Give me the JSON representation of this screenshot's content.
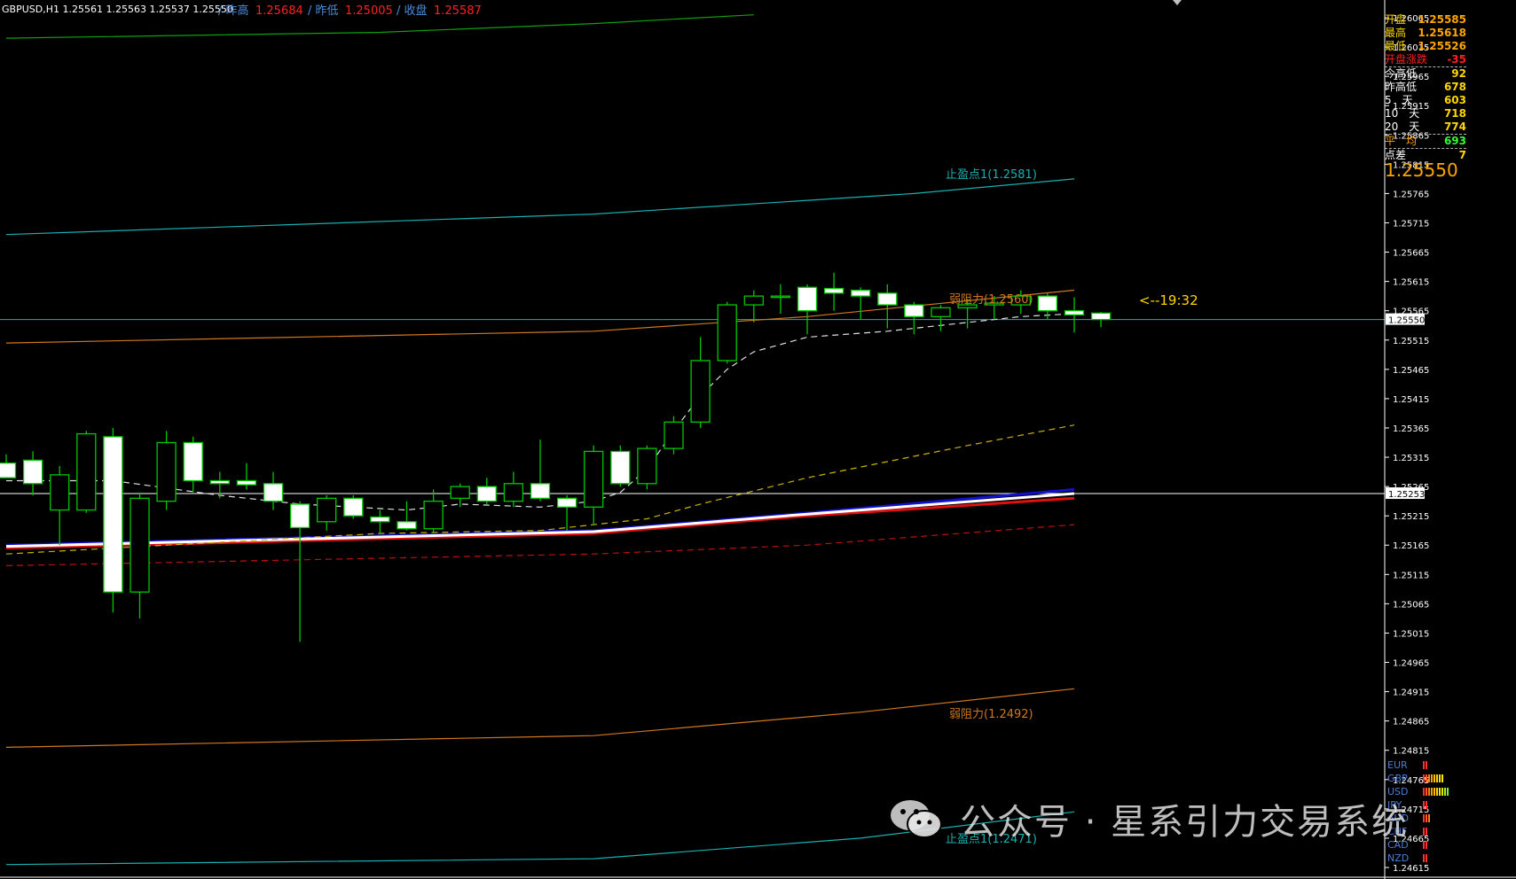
{
  "window": {
    "symbol_line": "GBPUSD,H1  1.25561 1.25563 1.25537 1.25550",
    "prev_high_label": "/ 昨高",
    "prev_high_value": "1.25684",
    "prev_low_label": "/ 昨低",
    "prev_low_value": "1.25005",
    "prev_close_label": "/ 收盘",
    "prev_close_value": "1.25587"
  },
  "stats_panel": {
    "rows": [
      {
        "label": "开盘",
        "value": "1.25585",
        "label_color": "#ffd700",
        "value_color": "#ffa500"
      },
      {
        "label": "最高",
        "value": "1.25618",
        "label_color": "#ffd700",
        "value_color": "#ffa500"
      },
      {
        "label": "最低",
        "value": "1.25526",
        "label_color": "#ffd700",
        "value_color": "#ffa500"
      },
      {
        "label": "开盘涨跌",
        "value": "-35",
        "label_color": "#ff2020",
        "value_color": "#ff2020"
      },
      {
        "label": "今高低",
        "value": "92",
        "label_color": "#ffffff",
        "value_color": "#ffd700"
      },
      {
        "label": "昨高低",
        "value": "678",
        "label_color": "#ffffff",
        "value_color": "#ffd700"
      },
      {
        "label": "5　天",
        "value": "603",
        "label_color": "#ffffff",
        "value_color": "#ffd700"
      },
      {
        "label": "10　天",
        "value": "718",
        "label_color": "#ffffff",
        "value_color": "#ffd700"
      },
      {
        "label": "20　天",
        "value": "774",
        "label_color": "#ffffff",
        "value_color": "#ffd700"
      },
      {
        "label": "平　均",
        "value": "693",
        "label_color": "#ffa500",
        "value_color": "#33ff33"
      },
      {
        "label": "点差",
        "value": "7",
        "label_color": "#ffffff",
        "value_color": "#ffd700"
      }
    ],
    "current_price": "1.25550"
  },
  "annotations": {
    "tp_upper": "止盈点1(1.2581)",
    "resist_upper": "弱阻力(1.2560)",
    "timer": "<--19:32",
    "resist_lower": "弱阻力(1.2492)",
    "tp_lower": "止盈点1(1.2471)"
  },
  "currency_strength": [
    {
      "name": "EUR",
      "level": 2,
      "colors": [
        "#ff3030",
        "#ff3030"
      ]
    },
    {
      "name": "GBP",
      "level": 8,
      "colors": [
        "#ff3030",
        "#ff5a20",
        "#ff8010",
        "#ffa000",
        "#ffc000",
        "#ffd400",
        "#ffe000",
        "#ffe800"
      ]
    },
    {
      "name": "USD",
      "level": 10,
      "colors": [
        "#ff3030",
        "#ff5a20",
        "#ff8010",
        "#ffa000",
        "#ffc000",
        "#ffd400",
        "#ffe000",
        "#d8f000",
        "#a8f020",
        "#70f030"
      ]
    },
    {
      "name": "JPY",
      "level": 2,
      "colors": [
        "#ff3030",
        "#ff3030"
      ]
    },
    {
      "name": "AUD",
      "level": 3,
      "colors": [
        "#ff3030",
        "#ff5a20",
        "#ff8010"
      ]
    },
    {
      "name": "CHF",
      "level": 2,
      "colors": [
        "#ff3030",
        "#ff3030"
      ]
    },
    {
      "name": "CAD",
      "level": 2,
      "colors": [
        "#ff3030",
        "#ff3030"
      ]
    },
    {
      "name": "NZD",
      "level": 2,
      "colors": [
        "#ff3030",
        "#ff3030"
      ]
    }
  ],
  "watermark": "公众号 · 星系引力交易系统",
  "colors": {
    "background": "#000000",
    "bull_candle": "#000000",
    "bear_candle": "#ffffff",
    "wick": "#00c800",
    "tp_line": "#1ab0b0",
    "resist_line": "#d07820",
    "ma_white": "#ffffff",
    "ma_blue": "#1010d0",
    "ma_red": "#e01010",
    "ma_dashed_red": "#c01010",
    "ma_dashed_yellow": "#c8b400",
    "ma_dashed_white": "#e0e0e0",
    "top_green": "#10a010",
    "hline": "#ffffff",
    "price_line": "#1ab0b0"
  },
  "chart_data": {
    "type": "candlestick",
    "symbol": "GBPUSD",
    "timeframe": "H1",
    "ylim": [
      1.24615,
      1.26065
    ],
    "y_ticks": [
      "1.26065",
      "1.26015",
      "1.25965",
      "1.25915",
      "1.25865",
      "1.25815",
      "1.25765",
      "1.25715",
      "1.25665",
      "1.25615",
      "1.25565",
      "1.25515",
      "1.25465",
      "1.25415",
      "1.25365",
      "1.25315",
      "1.25265",
      "1.25215",
      "1.25165",
      "1.25115",
      "1.25065",
      "1.25015",
      "1.24965",
      "1.24915",
      "1.24865",
      "1.24815",
      "1.24765",
      "1.24715",
      "1.24665",
      "1.24615"
    ],
    "price_labels": [
      {
        "value": "1.25550",
        "y": 1.2555
      },
      {
        "value": "1.25253",
        "y": 1.25253
      }
    ],
    "horizontal_lines": [
      1.25253
    ],
    "candles": [
      {
        "o": 1.25305,
        "h": 1.2532,
        "l": 1.2528,
        "c": 1.2528
      },
      {
        "o": 1.2531,
        "h": 1.25325,
        "l": 1.2525,
        "c": 1.2527
      },
      {
        "o": 1.25225,
        "h": 1.253,
        "l": 1.25165,
        "c": 1.25285
      },
      {
        "o": 1.25225,
        "h": 1.2536,
        "l": 1.2522,
        "c": 1.25355
      },
      {
        "o": 1.2535,
        "h": 1.25365,
        "l": 1.2505,
        "c": 1.25085
      },
      {
        "o": 1.25085,
        "h": 1.25255,
        "l": 1.2504,
        "c": 1.25245
      },
      {
        "o": 1.2524,
        "h": 1.2536,
        "l": 1.25225,
        "c": 1.2534
      },
      {
        "o": 1.2534,
        "h": 1.2535,
        "l": 1.25255,
        "c": 1.25275
      },
      {
        "o": 1.25275,
        "h": 1.2529,
        "l": 1.25245,
        "c": 1.2527
      },
      {
        "o": 1.25275,
        "h": 1.25305,
        "l": 1.2526,
        "c": 1.25268
      },
      {
        "o": 1.2527,
        "h": 1.2529,
        "l": 1.25225,
        "c": 1.2524
      },
      {
        "o": 1.25235,
        "h": 1.2524,
        "l": 1.25,
        "c": 1.25195
      },
      {
        "o": 1.25205,
        "h": 1.2525,
        "l": 1.2519,
        "c": 1.25245
      },
      {
        "o": 1.25245,
        "h": 1.2525,
        "l": 1.2521,
        "c": 1.25215
      },
      {
        "o": 1.25213,
        "h": 1.25225,
        "l": 1.25185,
        "c": 1.25205
      },
      {
        "o": 1.25205,
        "h": 1.2524,
        "l": 1.2519,
        "c": 1.25193
      },
      {
        "o": 1.25193,
        "h": 1.2526,
        "l": 1.25185,
        "c": 1.2524
      },
      {
        "o": 1.25245,
        "h": 1.2527,
        "l": 1.2523,
        "c": 1.25265
      },
      {
        "o": 1.25265,
        "h": 1.2528,
        "l": 1.25235,
        "c": 1.2524
      },
      {
        "o": 1.2524,
        "h": 1.2529,
        "l": 1.2523,
        "c": 1.2527
      },
      {
        "o": 1.2527,
        "h": 1.25345,
        "l": 1.2524,
        "c": 1.25245
      },
      {
        "o": 1.25245,
        "h": 1.2525,
        "l": 1.2519,
        "c": 1.2523
      },
      {
        "o": 1.2523,
        "h": 1.25335,
        "l": 1.252,
        "c": 1.25325
      },
      {
        "o": 1.25325,
        "h": 1.25335,
        "l": 1.25265,
        "c": 1.2527
      },
      {
        "o": 1.2527,
        "h": 1.25335,
        "l": 1.2526,
        "c": 1.2533
      },
      {
        "o": 1.2533,
        "h": 1.25385,
        "l": 1.2532,
        "c": 1.25375
      },
      {
        "o": 1.25375,
        "h": 1.2552,
        "l": 1.25365,
        "c": 1.2548
      },
      {
        "o": 1.2548,
        "h": 1.2558,
        "l": 1.25475,
        "c": 1.25575
      },
      {
        "o": 1.25575,
        "h": 1.256,
        "l": 1.25545,
        "c": 1.2559
      },
      {
        "o": 1.2559,
        "h": 1.2561,
        "l": 1.2556,
        "c": 1.2559
      },
      {
        "o": 1.25605,
        "h": 1.2561,
        "l": 1.25525,
        "c": 1.25565
      },
      {
        "o": 1.25603,
        "h": 1.2563,
        "l": 1.25565,
        "c": 1.25595
      },
      {
        "o": 1.256,
        "h": 1.25605,
        "l": 1.2555,
        "c": 1.2559
      },
      {
        "o": 1.25595,
        "h": 1.2561,
        "l": 1.25535,
        "c": 1.25575
      },
      {
        "o": 1.25575,
        "h": 1.2558,
        "l": 1.25525,
        "c": 1.25555
      },
      {
        "o": 1.25555,
        "h": 1.25575,
        "l": 1.2553,
        "c": 1.2557
      },
      {
        "o": 1.2557,
        "h": 1.25585,
        "l": 1.25535,
        "c": 1.25575
      },
      {
        "o": 1.25575,
        "h": 1.2559,
        "l": 1.2555,
        "c": 1.25578
      },
      {
        "o": 1.25575,
        "h": 1.256,
        "l": 1.2556,
        "c": 1.2559
      },
      {
        "o": 1.2559,
        "h": 1.25595,
        "l": 1.2555,
        "c": 1.25565
      },
      {
        "o": 1.25565,
        "h": 1.25588,
        "l": 1.25528,
        "c": 1.25558
      },
      {
        "o": 1.25561,
        "h": 1.25563,
        "l": 1.25537,
        "c": 1.2555
      }
    ],
    "lines": [
      {
        "name": "tp_upper",
        "style": "solid",
        "color_key": "tp_line",
        "pts": [
          [
            0,
            1.25695
          ],
          [
            22,
            1.2573
          ],
          [
            34,
            1.25765
          ],
          [
            40,
            1.2579
          ]
        ]
      },
      {
        "name": "resist_upper",
        "style": "solid",
        "color_key": "resist_line",
        "pts": [
          [
            0,
            1.2551
          ],
          [
            22,
            1.2553
          ],
          [
            30,
            1.25555
          ],
          [
            40,
            1.256
          ]
        ]
      },
      {
        "name": "tp_lower",
        "style": "solid",
        "color_key": "tp_line",
        "pts": [
          [
            0,
            1.2462
          ],
          [
            22,
            1.2463
          ],
          [
            32,
            1.24665
          ],
          [
            40,
            1.2471
          ]
        ]
      },
      {
        "name": "resist_lower",
        "style": "solid",
        "color_key": "resist_line",
        "pts": [
          [
            0,
            1.2482
          ],
          [
            22,
            1.2484
          ],
          [
            32,
            1.2488
          ],
          [
            40,
            1.2492
          ]
        ]
      },
      {
        "name": "top_green",
        "style": "solid",
        "color_key": "top_green",
        "pts": [
          [
            0,
            1.2603
          ],
          [
            14,
            1.2604
          ],
          [
            22,
            1.26055
          ],
          [
            28,
            1.2607
          ]
        ]
      },
      {
        "name": "ma_dashed_red",
        "style": "dashed",
        "color_key": "ma_dashed_red",
        "pts": [
          [
            0,
            1.2513
          ],
          [
            22,
            1.2515
          ],
          [
            30,
            1.25165
          ],
          [
            40,
            1.252
          ]
        ]
      },
      {
        "name": "ma_red",
        "style": "solid",
        "color_key": "ma_red",
        "pts": [
          [
            0,
            1.2516
          ],
          [
            22,
            1.25185
          ],
          [
            30,
            1.25215
          ],
          [
            40,
            1.25245
          ]
        ]
      },
      {
        "name": "ma_blue",
        "style": "solid",
        "color_key": "ma_blue",
        "pts": [
          [
            0,
            1.25165
          ],
          [
            22,
            1.2519
          ],
          [
            30,
            1.2522
          ],
          [
            40,
            1.2526
          ]
        ]
      },
      {
        "name": "ma_white",
        "style": "solid",
        "color_key": "ma_white",
        "pts": [
          [
            0,
            1.25163
          ],
          [
            22,
            1.25188
          ],
          [
            30,
            1.25218
          ],
          [
            40,
            1.25253
          ]
        ]
      },
      {
        "name": "ma_dashed_yellow",
        "style": "dashed",
        "color_key": "ma_dashed_yellow",
        "pts": [
          [
            0,
            1.2515
          ],
          [
            14,
            1.25185
          ],
          [
            20,
            1.2519
          ],
          [
            24,
            1.2521
          ],
          [
            26,
            1.25235
          ],
          [
            30,
            1.2528
          ],
          [
            36,
            1.25335
          ],
          [
            40,
            1.2537
          ]
        ]
      },
      {
        "name": "ma_dashed_white",
        "style": "dashed",
        "color_key": "ma_dashed_white",
        "pts": [
          [
            0,
            1.25275
          ],
          [
            4,
            1.25275
          ],
          [
            8,
            1.2525
          ],
          [
            11,
            1.25235
          ],
          [
            15,
            1.25225
          ],
          [
            17,
            1.25235
          ],
          [
            20,
            1.2523
          ],
          [
            22,
            1.2524
          ],
          [
            23,
            1.25255
          ],
          [
            24,
            1.25295
          ],
          [
            25,
            1.2536
          ],
          [
            26,
            1.2542
          ],
          [
            27,
            1.25465
          ],
          [
            28,
            1.25495
          ],
          [
            30,
            1.2552
          ],
          [
            33,
            1.2553
          ],
          [
            36,
            1.25545
          ],
          [
            38,
            1.25555
          ],
          [
            40,
            1.2556
          ]
        ]
      }
    ],
    "price_line": 1.2555
  }
}
